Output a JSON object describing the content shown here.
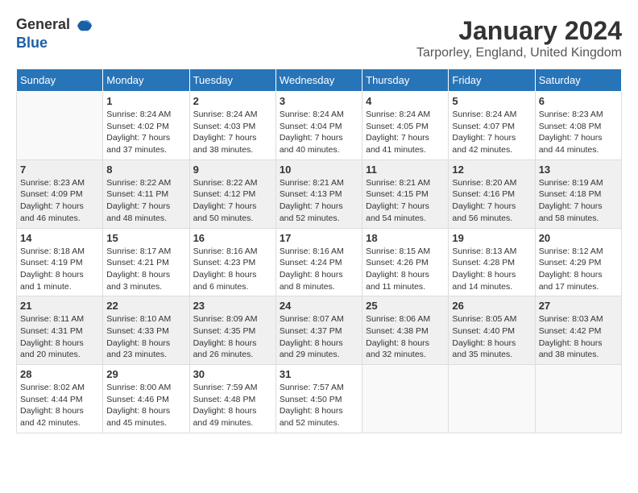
{
  "header": {
    "logo_general": "General",
    "logo_blue": "Blue",
    "month_year": "January 2024",
    "location": "Tarporley, England, United Kingdom"
  },
  "days_of_week": [
    "Sunday",
    "Monday",
    "Tuesday",
    "Wednesday",
    "Thursday",
    "Friday",
    "Saturday"
  ],
  "weeks": [
    {
      "shade": "white",
      "days": [
        {
          "num": "",
          "sunrise": "",
          "sunset": "",
          "daylight": ""
        },
        {
          "num": "1",
          "sunrise": "Sunrise: 8:24 AM",
          "sunset": "Sunset: 4:02 PM",
          "daylight": "Daylight: 7 hours and 37 minutes."
        },
        {
          "num": "2",
          "sunrise": "Sunrise: 8:24 AM",
          "sunset": "Sunset: 4:03 PM",
          "daylight": "Daylight: 7 hours and 38 minutes."
        },
        {
          "num": "3",
          "sunrise": "Sunrise: 8:24 AM",
          "sunset": "Sunset: 4:04 PM",
          "daylight": "Daylight: 7 hours and 40 minutes."
        },
        {
          "num": "4",
          "sunrise": "Sunrise: 8:24 AM",
          "sunset": "Sunset: 4:05 PM",
          "daylight": "Daylight: 7 hours and 41 minutes."
        },
        {
          "num": "5",
          "sunrise": "Sunrise: 8:24 AM",
          "sunset": "Sunset: 4:07 PM",
          "daylight": "Daylight: 7 hours and 42 minutes."
        },
        {
          "num": "6",
          "sunrise": "Sunrise: 8:23 AM",
          "sunset": "Sunset: 4:08 PM",
          "daylight": "Daylight: 7 hours and 44 minutes."
        }
      ]
    },
    {
      "shade": "shaded",
      "days": [
        {
          "num": "7",
          "sunrise": "Sunrise: 8:23 AM",
          "sunset": "Sunset: 4:09 PM",
          "daylight": "Daylight: 7 hours and 46 minutes."
        },
        {
          "num": "8",
          "sunrise": "Sunrise: 8:22 AM",
          "sunset": "Sunset: 4:11 PM",
          "daylight": "Daylight: 7 hours and 48 minutes."
        },
        {
          "num": "9",
          "sunrise": "Sunrise: 8:22 AM",
          "sunset": "Sunset: 4:12 PM",
          "daylight": "Daylight: 7 hours and 50 minutes."
        },
        {
          "num": "10",
          "sunrise": "Sunrise: 8:21 AM",
          "sunset": "Sunset: 4:13 PM",
          "daylight": "Daylight: 7 hours and 52 minutes."
        },
        {
          "num": "11",
          "sunrise": "Sunrise: 8:21 AM",
          "sunset": "Sunset: 4:15 PM",
          "daylight": "Daylight: 7 hours and 54 minutes."
        },
        {
          "num": "12",
          "sunrise": "Sunrise: 8:20 AM",
          "sunset": "Sunset: 4:16 PM",
          "daylight": "Daylight: 7 hours and 56 minutes."
        },
        {
          "num": "13",
          "sunrise": "Sunrise: 8:19 AM",
          "sunset": "Sunset: 4:18 PM",
          "daylight": "Daylight: 7 hours and 58 minutes."
        }
      ]
    },
    {
      "shade": "white",
      "days": [
        {
          "num": "14",
          "sunrise": "Sunrise: 8:18 AM",
          "sunset": "Sunset: 4:19 PM",
          "daylight": "Daylight: 8 hours and 1 minute."
        },
        {
          "num": "15",
          "sunrise": "Sunrise: 8:17 AM",
          "sunset": "Sunset: 4:21 PM",
          "daylight": "Daylight: 8 hours and 3 minutes."
        },
        {
          "num": "16",
          "sunrise": "Sunrise: 8:16 AM",
          "sunset": "Sunset: 4:23 PM",
          "daylight": "Daylight: 8 hours and 6 minutes."
        },
        {
          "num": "17",
          "sunrise": "Sunrise: 8:16 AM",
          "sunset": "Sunset: 4:24 PM",
          "daylight": "Daylight: 8 hours and 8 minutes."
        },
        {
          "num": "18",
          "sunrise": "Sunrise: 8:15 AM",
          "sunset": "Sunset: 4:26 PM",
          "daylight": "Daylight: 8 hours and 11 minutes."
        },
        {
          "num": "19",
          "sunrise": "Sunrise: 8:13 AM",
          "sunset": "Sunset: 4:28 PM",
          "daylight": "Daylight: 8 hours and 14 minutes."
        },
        {
          "num": "20",
          "sunrise": "Sunrise: 8:12 AM",
          "sunset": "Sunset: 4:29 PM",
          "daylight": "Daylight: 8 hours and 17 minutes."
        }
      ]
    },
    {
      "shade": "shaded",
      "days": [
        {
          "num": "21",
          "sunrise": "Sunrise: 8:11 AM",
          "sunset": "Sunset: 4:31 PM",
          "daylight": "Daylight: 8 hours and 20 minutes."
        },
        {
          "num": "22",
          "sunrise": "Sunrise: 8:10 AM",
          "sunset": "Sunset: 4:33 PM",
          "daylight": "Daylight: 8 hours and 23 minutes."
        },
        {
          "num": "23",
          "sunrise": "Sunrise: 8:09 AM",
          "sunset": "Sunset: 4:35 PM",
          "daylight": "Daylight: 8 hours and 26 minutes."
        },
        {
          "num": "24",
          "sunrise": "Sunrise: 8:07 AM",
          "sunset": "Sunset: 4:37 PM",
          "daylight": "Daylight: 8 hours and 29 minutes."
        },
        {
          "num": "25",
          "sunrise": "Sunrise: 8:06 AM",
          "sunset": "Sunset: 4:38 PM",
          "daylight": "Daylight: 8 hours and 32 minutes."
        },
        {
          "num": "26",
          "sunrise": "Sunrise: 8:05 AM",
          "sunset": "Sunset: 4:40 PM",
          "daylight": "Daylight: 8 hours and 35 minutes."
        },
        {
          "num": "27",
          "sunrise": "Sunrise: 8:03 AM",
          "sunset": "Sunset: 4:42 PM",
          "daylight": "Daylight: 8 hours and 38 minutes."
        }
      ]
    },
    {
      "shade": "white",
      "days": [
        {
          "num": "28",
          "sunrise": "Sunrise: 8:02 AM",
          "sunset": "Sunset: 4:44 PM",
          "daylight": "Daylight: 8 hours and 42 minutes."
        },
        {
          "num": "29",
          "sunrise": "Sunrise: 8:00 AM",
          "sunset": "Sunset: 4:46 PM",
          "daylight": "Daylight: 8 hours and 45 minutes."
        },
        {
          "num": "30",
          "sunrise": "Sunrise: 7:59 AM",
          "sunset": "Sunset: 4:48 PM",
          "daylight": "Daylight: 8 hours and 49 minutes."
        },
        {
          "num": "31",
          "sunrise": "Sunrise: 7:57 AM",
          "sunset": "Sunset: 4:50 PM",
          "daylight": "Daylight: 8 hours and 52 minutes."
        },
        {
          "num": "",
          "sunrise": "",
          "sunset": "",
          "daylight": ""
        },
        {
          "num": "",
          "sunrise": "",
          "sunset": "",
          "daylight": ""
        },
        {
          "num": "",
          "sunrise": "",
          "sunset": "",
          "daylight": ""
        }
      ]
    }
  ]
}
